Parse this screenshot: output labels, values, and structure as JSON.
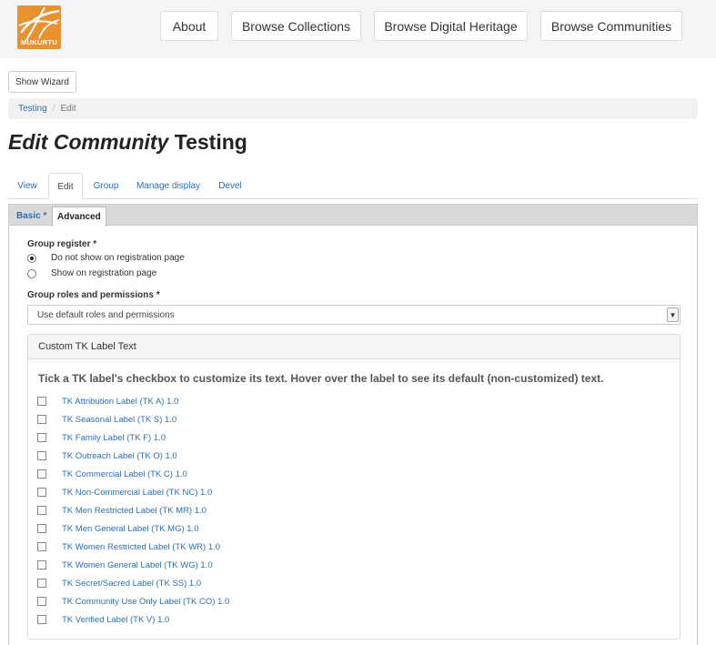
{
  "header": {
    "logo_text": "MUKURTU",
    "nav": [
      "About",
      "Browse Collections",
      "Browse Digital Heritage",
      "Browse Communities"
    ]
  },
  "toolbar": {
    "wizard_label": "Show Wizard"
  },
  "breadcrumb": {
    "link": "Testing",
    "separator": "/",
    "current": "Edit"
  },
  "title": {
    "prefix": "Edit Community",
    "name": "Testing"
  },
  "tabs": [
    "View",
    "Edit",
    "Group",
    "Manage display",
    "Devel"
  ],
  "vertical_tabs": {
    "basic": "Basic *",
    "advanced": "Advanced"
  },
  "form": {
    "group_register": {
      "label": "Group register *",
      "options": [
        "Do not show on registration page",
        "Show on registration page"
      ],
      "selected": "Do not show on registration page"
    },
    "group_roles": {
      "label": "Group roles and permissions *",
      "value": "Use default roles and permissions"
    },
    "tk_fieldset": {
      "title": "Custom TK Label Text",
      "description": "Tick a TK label's checkbox to customize its text. Hover over the label to see its default (non-customized) text.",
      "labels": [
        "TK Attribution Label (TK A) 1.0",
        "TK Seasonal Label (TK S) 1.0",
        "TK Family Label (TK F) 1.0",
        "TK Outreach Label (TK O) 1.0",
        "TK Commercial Label (TK C) 1.0",
        "TK Non-Commercial Label (TK NC) 1.0",
        "TK Men Restricted Label (TK MR) 1.0",
        "TK Men General Label (TK MG) 1.0",
        "TK Women Restricted Label (TK WR) 1.0",
        "TK Women General Label (TK WG) 1.0",
        "TK Secret/Sacred Label (TK SS) 1.0",
        "TK Community Use Only Label (TK CO) 1.0",
        "TK Verified Label (TK V) 1.0"
      ]
    }
  },
  "colors": {
    "brand": "#e8912e",
    "link": "#2a6fb5"
  }
}
